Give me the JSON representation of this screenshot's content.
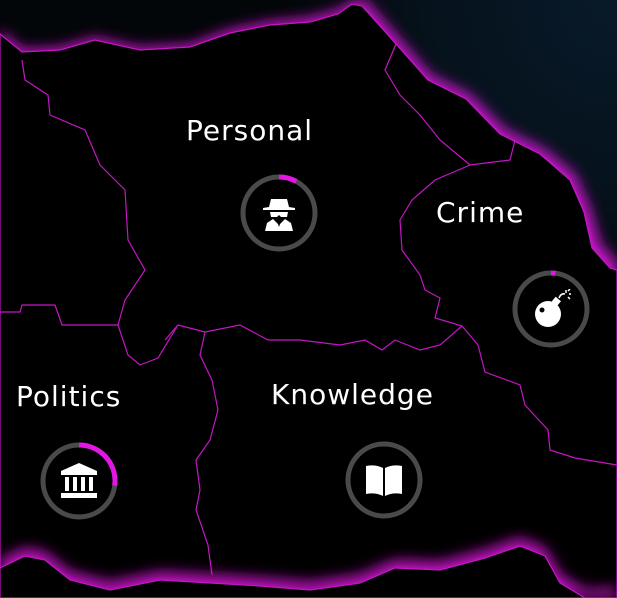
{
  "colors": {
    "accent": "#e516e5",
    "border": "#c416c4",
    "ring_track": "#4a4a4a",
    "background_top_right": "#071623"
  },
  "regions": [
    {
      "id": "personal",
      "label": "Personal",
      "icon": "spy-icon",
      "progress": 0.08
    },
    {
      "id": "crime",
      "label": "Crime",
      "icon": "bomb-icon",
      "progress": 0.02
    },
    {
      "id": "politics",
      "label": "Politics",
      "icon": "government-icon",
      "progress": 0.27
    },
    {
      "id": "knowledge",
      "label": "Knowledge",
      "icon": "book-icon",
      "progress": 0.0
    }
  ]
}
